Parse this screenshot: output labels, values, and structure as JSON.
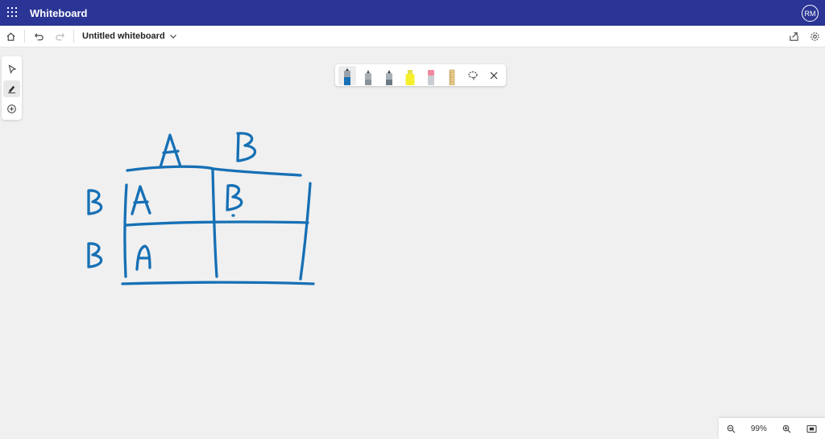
{
  "app": {
    "title": "Whiteboard",
    "user_initials": "RM"
  },
  "toolbar": {
    "board_name": "Untitled whiteboard"
  },
  "zoom": {
    "level": "99%"
  },
  "colors": {
    "titlebar": "#2b3595",
    "ink": "#1670b5",
    "highlighter": "#f5f02a",
    "eraser": "#f08aa0"
  },
  "pens": [
    {
      "name": "pen-blue",
      "color": "#1670b5",
      "selected": true
    },
    {
      "name": "pen-gray-1",
      "color": "#8a9299"
    },
    {
      "name": "pen-gray-2",
      "color": "#6d7a86"
    },
    {
      "name": "highlighter-yellow",
      "color": "#f5f02a"
    },
    {
      "name": "eraser",
      "color": "#f08aa0"
    },
    {
      "name": "ruler",
      "color": "#d8b878"
    }
  ],
  "canvas": {
    "column_headers": [
      "A",
      "B"
    ],
    "row_headers": [
      "B",
      "B"
    ],
    "cells": [
      "A",
      "B",
      "A",
      ""
    ]
  }
}
